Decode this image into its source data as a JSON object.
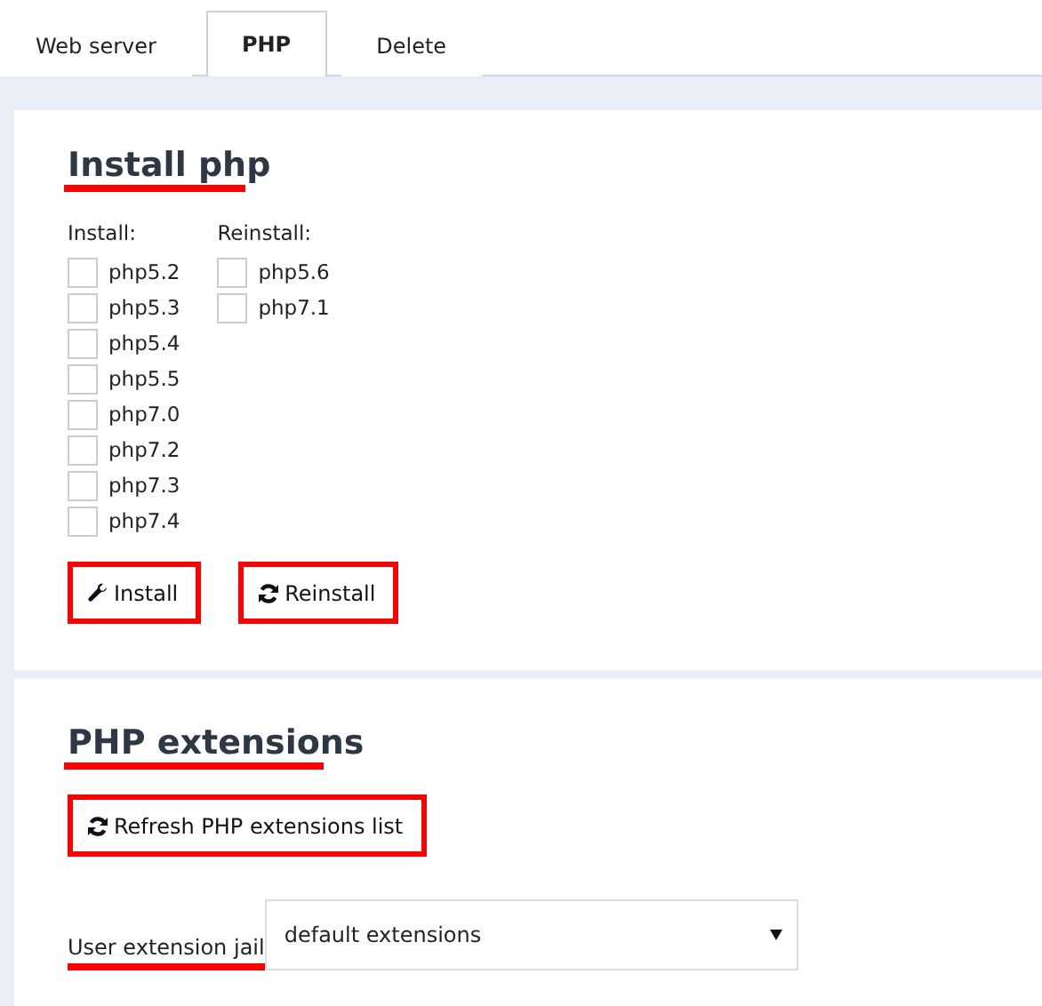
{
  "tabs": [
    {
      "label": "Web server",
      "selected": false
    },
    {
      "label": "PHP",
      "selected": true
    },
    {
      "label": "Delete",
      "selected": false
    }
  ],
  "install_php": {
    "title": "Install php",
    "columns": [
      {
        "label": "Install:",
        "options": [
          {
            "label": "php5.2",
            "checked": false
          },
          {
            "label": "php5.3",
            "checked": false
          },
          {
            "label": "php5.4",
            "checked": false
          },
          {
            "label": "php5.5",
            "checked": false
          },
          {
            "label": "php7.0",
            "checked": false
          },
          {
            "label": "php7.2",
            "checked": false
          },
          {
            "label": "php7.3",
            "checked": false
          },
          {
            "label": "php7.4",
            "checked": false
          }
        ]
      },
      {
        "label": "Reinstall:",
        "options": [
          {
            "label": "php5.6",
            "checked": false
          },
          {
            "label": "php7.1",
            "checked": false
          }
        ]
      }
    ],
    "buttons": [
      {
        "label": "Install",
        "kind": "wrench"
      },
      {
        "label": "Reinstall",
        "kind": "refresh"
      }
    ]
  },
  "php_extensions": {
    "title": "PHP extensions",
    "refresh_button": {
      "label": "Refresh PHP extensions list",
      "kind": "refresh"
    },
    "jail_label": "User extension jail",
    "jail_select": {
      "value": "default extensions"
    }
  }
}
